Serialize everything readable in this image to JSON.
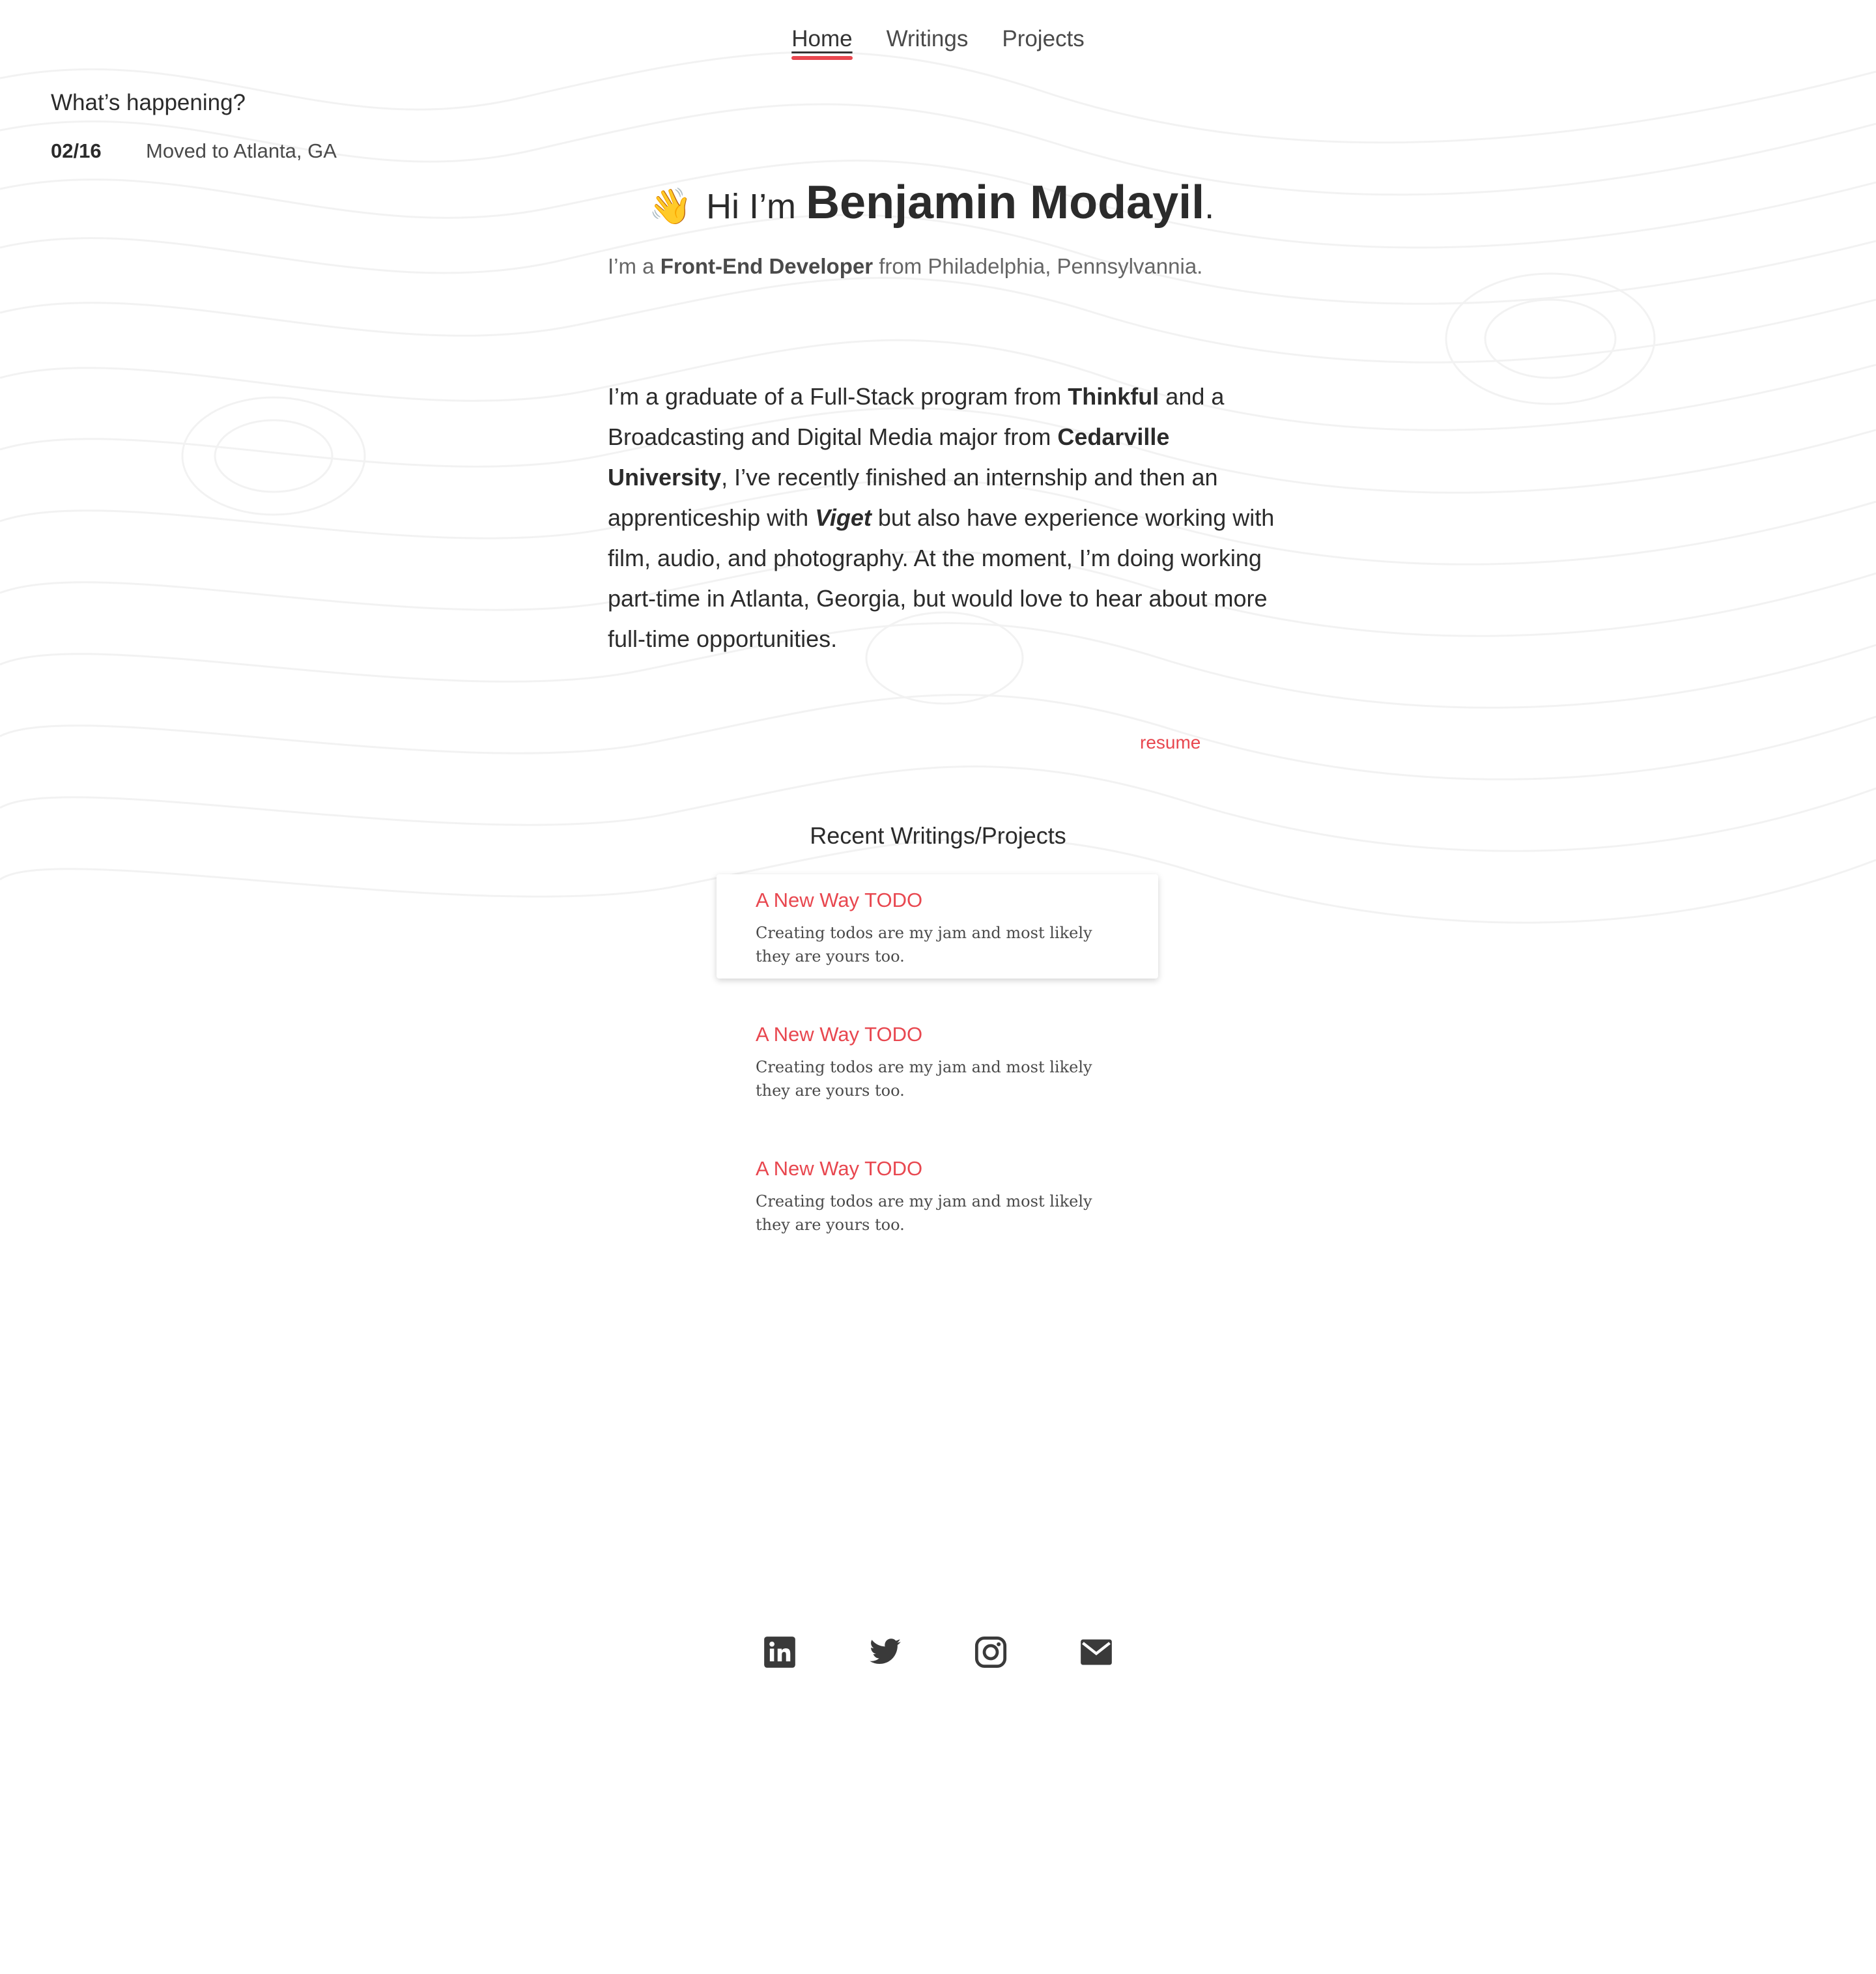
{
  "nav": {
    "items": [
      {
        "label": "Home",
        "active": true
      },
      {
        "label": "Writings",
        "active": false
      },
      {
        "label": "Projects",
        "active": false
      }
    ]
  },
  "happening": {
    "title": "What’s happening?",
    "items": [
      {
        "date": "02/16",
        "text": "Moved to Atlanta, GA"
      }
    ]
  },
  "hero": {
    "wave_emoji": "👋",
    "greeting_prefix": "Hi I’m",
    "name": "Benjamin Modayil",
    "punctuation": ".",
    "subtitle_prefix": "I’m a",
    "subtitle_role": "Front-End Developer",
    "subtitle_suffix": "from Philadelphia, Pennsylvannia."
  },
  "bio": {
    "p1": "I’m a graduate of a Full-Stack program from",
    "school1": "Thinkful",
    "p2": "and a Broadcasting and Digital Media major from",
    "school2": "Cedarville University",
    "p3": ", I’ve recently finished an internship and then an apprenticeship with",
    "company": "Viget",
    "p4": "but also have experience working with film, audio, and photography. At the moment, I’m doing working part-time in Atlanta, Georgia, but would love to hear about more full-time opportunities."
  },
  "resume_label": "resume",
  "recent": {
    "title": "Recent Writings/Projects",
    "items": [
      {
        "title": "A New Way TODO",
        "desc": "Creating todos are my jam and most likely they are yours too."
      },
      {
        "title": "A New Way TODO",
        "desc": "Creating todos are my jam and most likely they are yours too."
      },
      {
        "title": "A New Way TODO",
        "desc": "Creating todos are my jam and most likely they are yours too."
      }
    ]
  },
  "social": {
    "icons": [
      "linkedin-icon",
      "twitter-icon",
      "instagram-icon",
      "mail-icon"
    ]
  },
  "colors": {
    "accent": "#e8474f",
    "text": "#2b2b2b",
    "muted": "#4a4a4a",
    "icon": "#3a3a3a"
  }
}
